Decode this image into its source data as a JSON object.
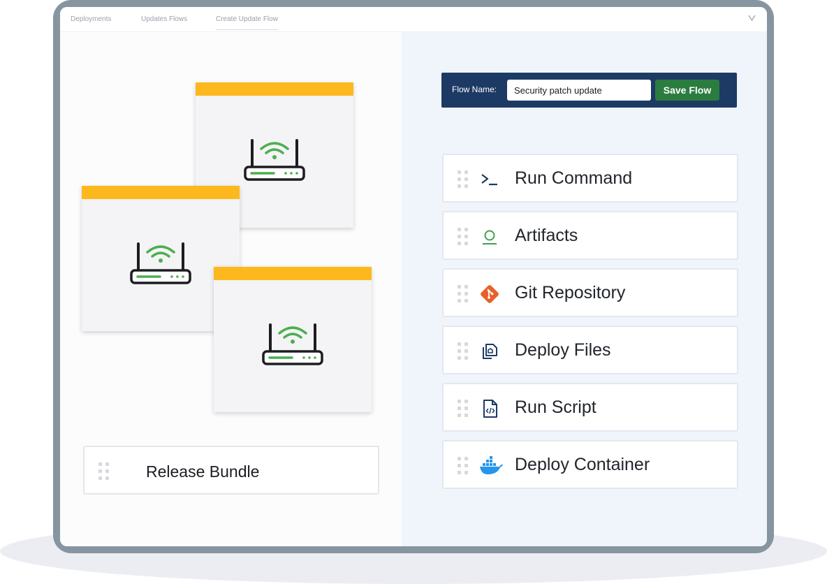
{
  "tabs": [
    {
      "label": "Deployments"
    },
    {
      "label": "Updates Flows"
    },
    {
      "label": "Create Update Flow",
      "active": true
    }
  ],
  "flow": {
    "name_label": "Flow Name:",
    "name_value": "Security patch update",
    "save_label": "Save Flow"
  },
  "left": {
    "release_bundle_label": "Release Bundle",
    "device_cards": [
      {
        "icon": "wifi-router-icon",
        "header_color": "#FDB81D"
      },
      {
        "icon": "wifi-router-icon",
        "header_color": "#FDB81D"
      },
      {
        "icon": "wifi-router-icon",
        "header_color": "#FDB81D"
      }
    ]
  },
  "steps": [
    {
      "label": "Run Command",
      "icon": "terminal-icon"
    },
    {
      "label": "Artifacts",
      "icon": "artifact-icon"
    },
    {
      "label": "Git Repository",
      "icon": "git-icon"
    },
    {
      "label": "Deploy Files",
      "icon": "files-icon"
    },
    {
      "label": "Run Script",
      "icon": "script-file-icon"
    },
    {
      "label": "Deploy Container",
      "icon": "docker-icon"
    }
  ],
  "colors": {
    "accent_yellow": "#FDB81D",
    "navy": "#1D3A64",
    "save_green": "#2B7D3F",
    "wifi_green": "#4CAF50",
    "git_orange": "#E8602C",
    "docker_blue": "#2496ED"
  }
}
